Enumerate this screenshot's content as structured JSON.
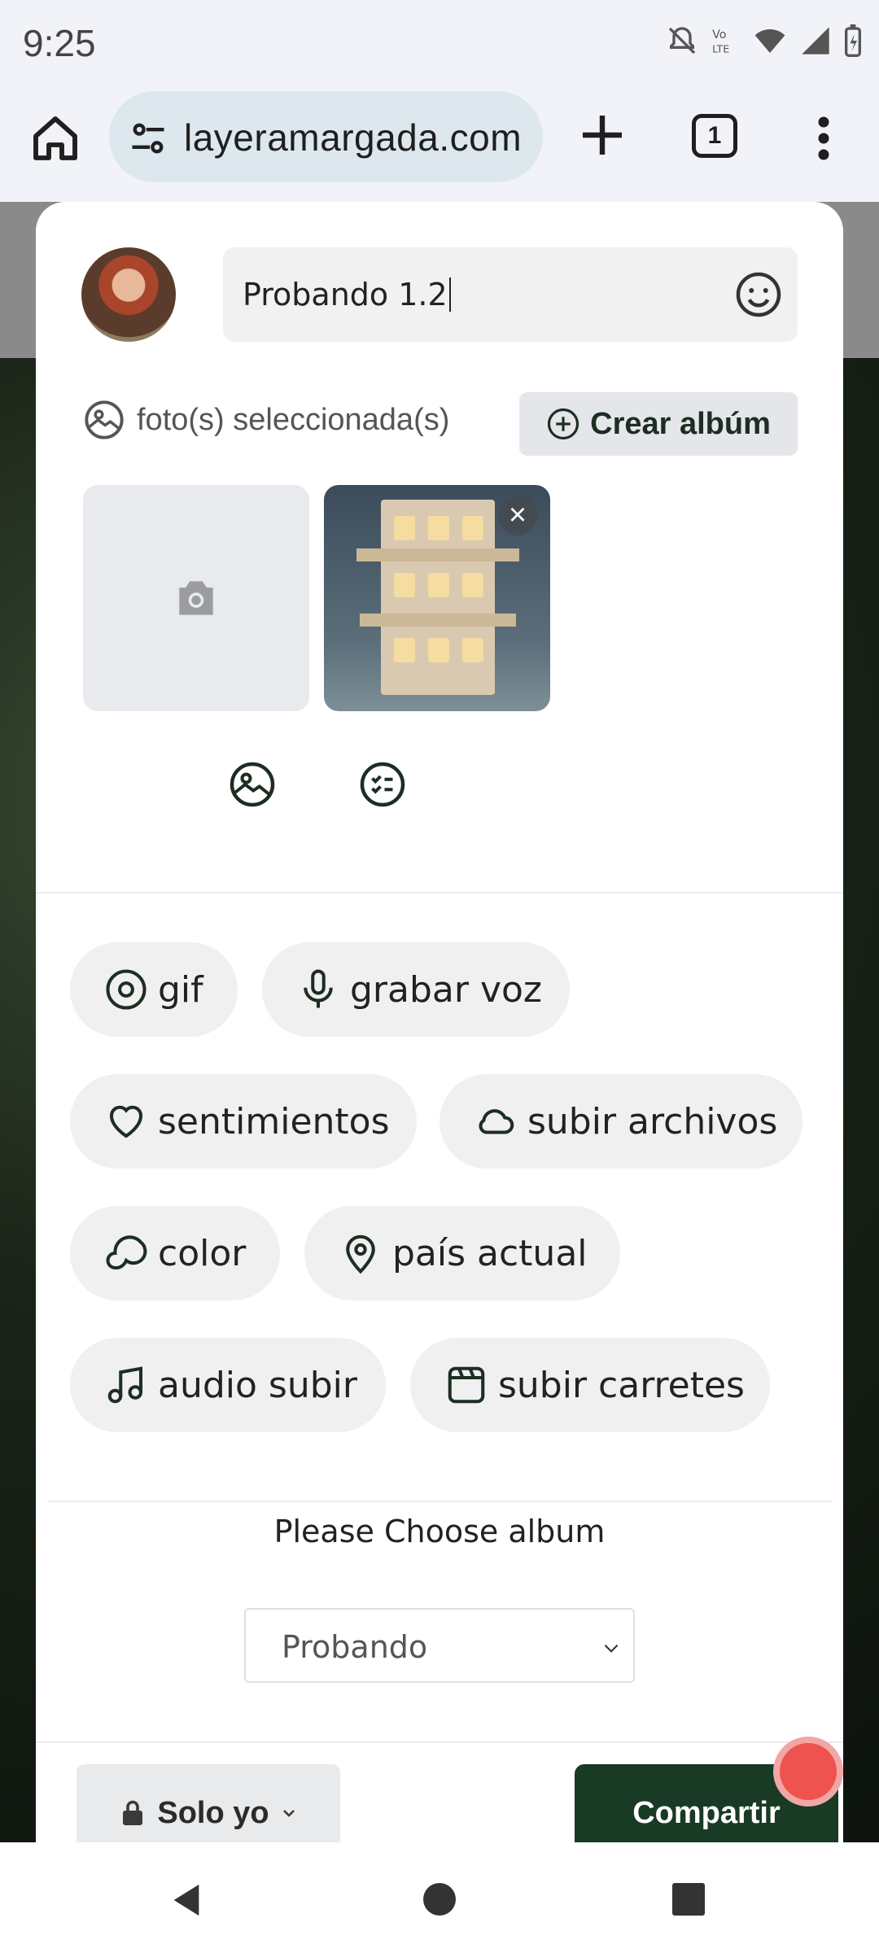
{
  "status_bar": {
    "time": "9:25"
  },
  "browser": {
    "url": "layeramargada.com",
    "tab_count": "1"
  },
  "composer": {
    "post_text": "Probando 1.2",
    "photos_selected_label": "foto(s) seleccionada(s)",
    "create_album_label": "Crear albúm"
  },
  "actions": [
    {
      "label": "gif",
      "icon": "gif-icon"
    },
    {
      "label": "grabar voz",
      "icon": "microphone-icon"
    },
    {
      "label": "sentimientos",
      "icon": "heart-icon"
    },
    {
      "label": "subir archivos",
      "icon": "cloud-icon"
    },
    {
      "label": "color",
      "icon": "color-palette-icon"
    },
    {
      "label": "país actual",
      "icon": "location-pin-icon"
    },
    {
      "label": "audio subir",
      "icon": "music-note-icon"
    },
    {
      "label": "subir carretes",
      "icon": "reels-icon"
    }
  ],
  "album": {
    "title": "Please Choose album",
    "selected": "Probando"
  },
  "footer": {
    "privacy_label": "Solo yo",
    "share_label": "Compartir"
  },
  "colors": {
    "brand_dark_green": "#193a24",
    "icon_green": "#1c2e21",
    "notification_red": "#ef5350"
  }
}
